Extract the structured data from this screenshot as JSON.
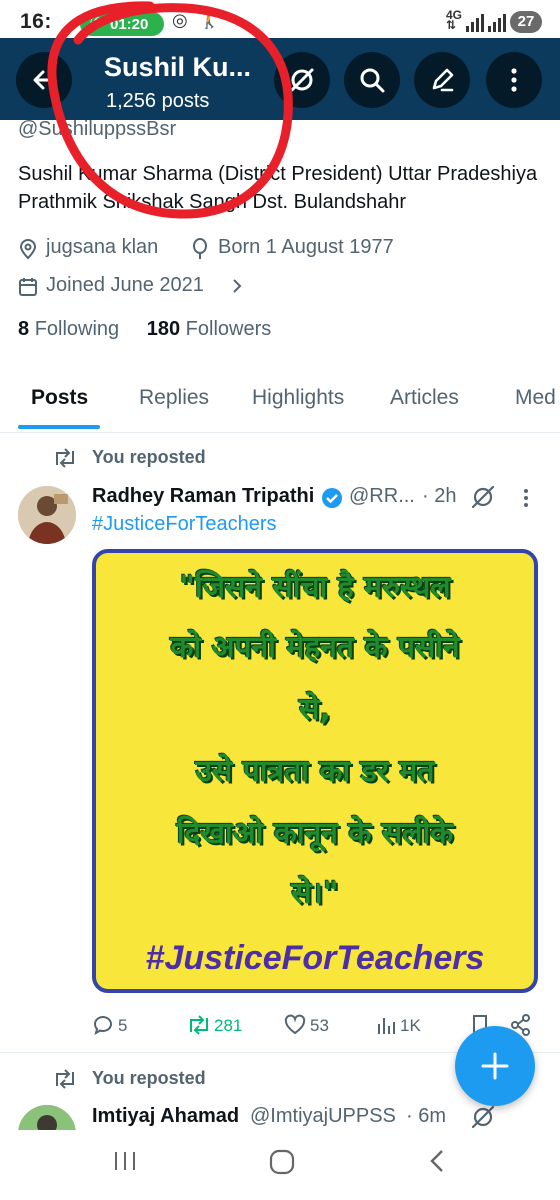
{
  "status_bar": {
    "time": "16:",
    "call_timer": "01:20",
    "network": "4G",
    "battery": "27"
  },
  "header": {
    "name": "Sushil Ku...",
    "posts_count": "1,256 posts"
  },
  "profile": {
    "handle": "@SushiluppssBsr",
    "bio": "Sushil Kumar Sharma (District President) Uttar Pradeshiya Prathmik Shikshak Sangh Dst. Bulandshahr",
    "location": "jugsana klan",
    "born": "Born 1 August 1977",
    "joined": "Joined June 2021",
    "following_count": "8",
    "following_label": "Following",
    "followers_count": "180",
    "followers_label": "Followers"
  },
  "tabs": [
    {
      "label": "Posts",
      "active": true
    },
    {
      "label": "Replies"
    },
    {
      "label": "Highlights"
    },
    {
      "label": "Articles"
    },
    {
      "label": "Med"
    }
  ],
  "posts": [
    {
      "repost_label": "You reposted",
      "author_name": "Radhey Raman Tripathi",
      "verified": true,
      "author_handle": "@RR...",
      "time": "· 2h",
      "hashtag": "#JusticeForTeachers",
      "image_text": {
        "line1": "\"जिसने सींचा है मरुस्थल",
        "line2": "को अपनी मेहनत के पसीने",
        "line3": "से,",
        "line4": "उसे पात्रता का डर मत",
        "line5": "दिखाओ कानून के सलीके",
        "line6": "से।\"",
        "tag": "#JusticeForTeachers"
      },
      "replies": "5",
      "reposts": "281",
      "likes": "53",
      "views": "1K"
    },
    {
      "repost_label": "You reposted",
      "author_name": "Imtiyaj Ahamad",
      "author_handle": "@ImtiyajUPPSS",
      "time": "· 6m"
    }
  ],
  "colors": {
    "header_bg": "#0b3a5c",
    "accent": "#1d9bf0",
    "repost_green": "#00ba7c",
    "poster_yellow": "#f9e63b",
    "poster_border": "#3345a8",
    "annotation_red": "#e8202a"
  },
  "icons": [
    "back-arrow-icon",
    "grok-icon",
    "search-icon",
    "edit-icon",
    "more-vert-icon",
    "location-icon",
    "balloon-icon",
    "calendar-icon",
    "chevron-right-icon",
    "repost-icon",
    "verified-icon",
    "reply-icon",
    "like-icon",
    "views-icon",
    "bookmark-icon",
    "share-icon",
    "plus-icon"
  ]
}
